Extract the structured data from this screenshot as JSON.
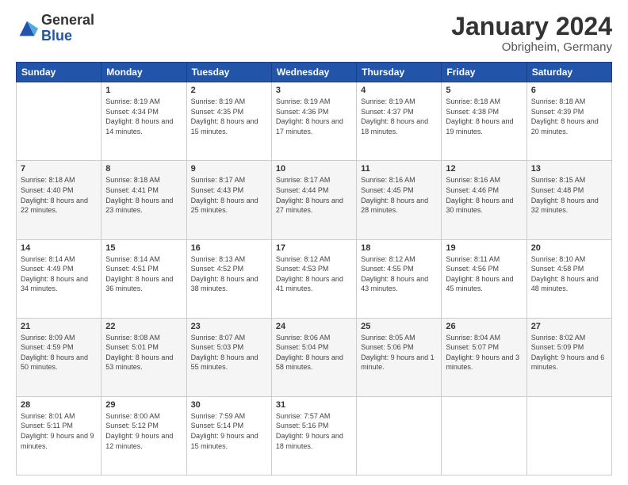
{
  "logo": {
    "general": "General",
    "blue": "Blue"
  },
  "header": {
    "month": "January 2024",
    "location": "Obrigheim, Germany"
  },
  "weekdays": [
    "Sunday",
    "Monday",
    "Tuesday",
    "Wednesday",
    "Thursday",
    "Friday",
    "Saturday"
  ],
  "weeks": [
    [
      {
        "day": null
      },
      {
        "day": "1",
        "sunrise": "Sunrise: 8:19 AM",
        "sunset": "Sunset: 4:34 PM",
        "daylight": "Daylight: 8 hours and 14 minutes."
      },
      {
        "day": "2",
        "sunrise": "Sunrise: 8:19 AM",
        "sunset": "Sunset: 4:35 PM",
        "daylight": "Daylight: 8 hours and 15 minutes."
      },
      {
        "day": "3",
        "sunrise": "Sunrise: 8:19 AM",
        "sunset": "Sunset: 4:36 PM",
        "daylight": "Daylight: 8 hours and 17 minutes."
      },
      {
        "day": "4",
        "sunrise": "Sunrise: 8:19 AM",
        "sunset": "Sunset: 4:37 PM",
        "daylight": "Daylight: 8 hours and 18 minutes."
      },
      {
        "day": "5",
        "sunrise": "Sunrise: 8:18 AM",
        "sunset": "Sunset: 4:38 PM",
        "daylight": "Daylight: 8 hours and 19 minutes."
      },
      {
        "day": "6",
        "sunrise": "Sunrise: 8:18 AM",
        "sunset": "Sunset: 4:39 PM",
        "daylight": "Daylight: 8 hours and 20 minutes."
      }
    ],
    [
      {
        "day": "7",
        "sunrise": "Sunrise: 8:18 AM",
        "sunset": "Sunset: 4:40 PM",
        "daylight": "Daylight: 8 hours and 22 minutes."
      },
      {
        "day": "8",
        "sunrise": "Sunrise: 8:18 AM",
        "sunset": "Sunset: 4:41 PM",
        "daylight": "Daylight: 8 hours and 23 minutes."
      },
      {
        "day": "9",
        "sunrise": "Sunrise: 8:17 AM",
        "sunset": "Sunset: 4:43 PM",
        "daylight": "Daylight: 8 hours and 25 minutes."
      },
      {
        "day": "10",
        "sunrise": "Sunrise: 8:17 AM",
        "sunset": "Sunset: 4:44 PM",
        "daylight": "Daylight: 8 hours and 27 minutes."
      },
      {
        "day": "11",
        "sunrise": "Sunrise: 8:16 AM",
        "sunset": "Sunset: 4:45 PM",
        "daylight": "Daylight: 8 hours and 28 minutes."
      },
      {
        "day": "12",
        "sunrise": "Sunrise: 8:16 AM",
        "sunset": "Sunset: 4:46 PM",
        "daylight": "Daylight: 8 hours and 30 minutes."
      },
      {
        "day": "13",
        "sunrise": "Sunrise: 8:15 AM",
        "sunset": "Sunset: 4:48 PM",
        "daylight": "Daylight: 8 hours and 32 minutes."
      }
    ],
    [
      {
        "day": "14",
        "sunrise": "Sunrise: 8:14 AM",
        "sunset": "Sunset: 4:49 PM",
        "daylight": "Daylight: 8 hours and 34 minutes."
      },
      {
        "day": "15",
        "sunrise": "Sunrise: 8:14 AM",
        "sunset": "Sunset: 4:51 PM",
        "daylight": "Daylight: 8 hours and 36 minutes."
      },
      {
        "day": "16",
        "sunrise": "Sunrise: 8:13 AM",
        "sunset": "Sunset: 4:52 PM",
        "daylight": "Daylight: 8 hours and 38 minutes."
      },
      {
        "day": "17",
        "sunrise": "Sunrise: 8:12 AM",
        "sunset": "Sunset: 4:53 PM",
        "daylight": "Daylight: 8 hours and 41 minutes."
      },
      {
        "day": "18",
        "sunrise": "Sunrise: 8:12 AM",
        "sunset": "Sunset: 4:55 PM",
        "daylight": "Daylight: 8 hours and 43 minutes."
      },
      {
        "day": "19",
        "sunrise": "Sunrise: 8:11 AM",
        "sunset": "Sunset: 4:56 PM",
        "daylight": "Daylight: 8 hours and 45 minutes."
      },
      {
        "day": "20",
        "sunrise": "Sunrise: 8:10 AM",
        "sunset": "Sunset: 4:58 PM",
        "daylight": "Daylight: 8 hours and 48 minutes."
      }
    ],
    [
      {
        "day": "21",
        "sunrise": "Sunrise: 8:09 AM",
        "sunset": "Sunset: 4:59 PM",
        "daylight": "Daylight: 8 hours and 50 minutes."
      },
      {
        "day": "22",
        "sunrise": "Sunrise: 8:08 AM",
        "sunset": "Sunset: 5:01 PM",
        "daylight": "Daylight: 8 hours and 53 minutes."
      },
      {
        "day": "23",
        "sunrise": "Sunrise: 8:07 AM",
        "sunset": "Sunset: 5:03 PM",
        "daylight": "Daylight: 8 hours and 55 minutes."
      },
      {
        "day": "24",
        "sunrise": "Sunrise: 8:06 AM",
        "sunset": "Sunset: 5:04 PM",
        "daylight": "Daylight: 8 hours and 58 minutes."
      },
      {
        "day": "25",
        "sunrise": "Sunrise: 8:05 AM",
        "sunset": "Sunset: 5:06 PM",
        "daylight": "Daylight: 9 hours and 1 minute."
      },
      {
        "day": "26",
        "sunrise": "Sunrise: 8:04 AM",
        "sunset": "Sunset: 5:07 PM",
        "daylight": "Daylight: 9 hours and 3 minutes."
      },
      {
        "day": "27",
        "sunrise": "Sunrise: 8:02 AM",
        "sunset": "Sunset: 5:09 PM",
        "daylight": "Daylight: 9 hours and 6 minutes."
      }
    ],
    [
      {
        "day": "28",
        "sunrise": "Sunrise: 8:01 AM",
        "sunset": "Sunset: 5:11 PM",
        "daylight": "Daylight: 9 hours and 9 minutes."
      },
      {
        "day": "29",
        "sunrise": "Sunrise: 8:00 AM",
        "sunset": "Sunset: 5:12 PM",
        "daylight": "Daylight: 9 hours and 12 minutes."
      },
      {
        "day": "30",
        "sunrise": "Sunrise: 7:59 AM",
        "sunset": "Sunset: 5:14 PM",
        "daylight": "Daylight: 9 hours and 15 minutes."
      },
      {
        "day": "31",
        "sunrise": "Sunrise: 7:57 AM",
        "sunset": "Sunset: 5:16 PM",
        "daylight": "Daylight: 9 hours and 18 minutes."
      },
      {
        "day": null
      },
      {
        "day": null
      },
      {
        "day": null
      }
    ]
  ]
}
